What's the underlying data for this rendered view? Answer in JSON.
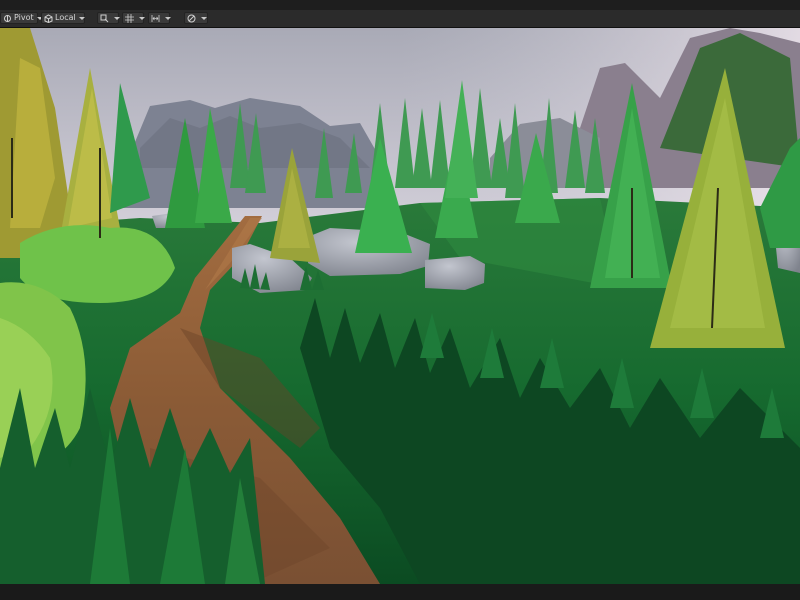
{
  "toolbar": {
    "pivot": {
      "label": "Pivot",
      "icon": "pivot-icon"
    },
    "local": {
      "label": "Local",
      "icon": "local-cube-icon"
    },
    "snap_icons": [
      "transform-icon",
      "grid-snap-icon",
      "increment-snap-icon",
      "visibility-icon"
    ]
  },
  "scene": {
    "description_icons": [
      "pine-tree",
      "rock",
      "grass",
      "dirt-path",
      "bush"
    ],
    "colors": {
      "sky_top": "#b3b3bf",
      "sky_bottom": "#dcd8e2",
      "grass_dark": "#0f4a25",
      "grass_mid": "#1f7a3a",
      "tree_yellow": "#b5a93a",
      "tree_green": "#2f9a3f",
      "path": "#8a5a35",
      "rock": "#a3a6b0"
    }
  }
}
